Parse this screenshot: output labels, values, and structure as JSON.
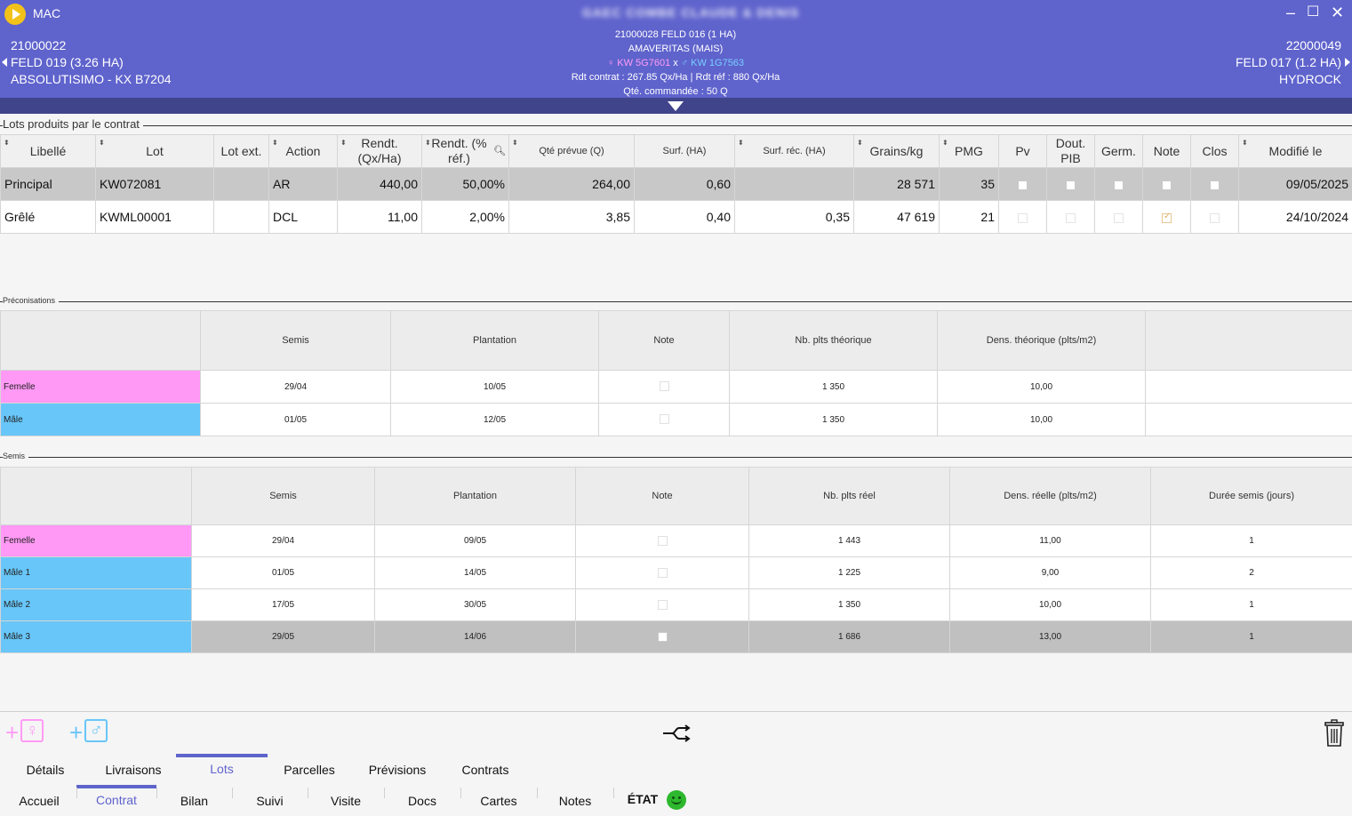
{
  "header": {
    "app_title": "MAC",
    "blurred_title": "GAEC COMBE CLAUDE & DENIS",
    "prev": {
      "line1": "21000022",
      "line2": "FELD 019 (3.26 HA)",
      "line3": "ABSOLUTISIMO - KX B7204"
    },
    "next": {
      "line1": "22000049",
      "line2": "FELD 017 (1.2 HA)",
      "line3": "HYDROCK"
    },
    "center": {
      "line1": "21000028 FELD 016 (1 HA)",
      "line2": "AMAVERITAS (MAIS)",
      "female": "KW 5G7601",
      "x": "x",
      "male": "KW 1G7563",
      "line4": "Rdt contrat : 267.85 Qx/Ha | Rdt réf : 880 Qx/Ha",
      "line5": "Qté. commandée : 50 Q"
    }
  },
  "lots": {
    "title": "Lots produits par le contrat",
    "headers": [
      "Libellé",
      "Lot",
      "Lot ext.",
      "Action",
      "Rendt. (Qx/Ha)",
      "Rendt. (% réf.)",
      "Qté prévue (Q)",
      "Surf. (HA)",
      "Surf. réc. (HA)",
      "Grains/kg",
      "PMG",
      "Pv",
      "Dout. PIB",
      "Germ.",
      "Note",
      "Clos",
      "Modifié le"
    ],
    "rows": [
      {
        "libelle": "Principal",
        "lot": "KW072081",
        "lot_ext": "",
        "action": "AR",
        "rendt": "440,00",
        "rendt_pct": "50,00%",
        "qte": "264,00",
        "surf": "0,60",
        "surf_rec": "",
        "grains": "28 571",
        "pmg": "35",
        "modifie": "09/05/2025"
      },
      {
        "libelle": "Grêlé",
        "lot": "KWML00001",
        "lot_ext": "",
        "action": "DCL",
        "rendt": "11,00",
        "rendt_pct": "2,00%",
        "qte": "3,85",
        "surf": "0,40",
        "surf_rec": "0,35",
        "grains": "47 619",
        "pmg": "21",
        "modifie": "24/10/2024"
      }
    ]
  },
  "precon": {
    "title": "Préconisations",
    "headers": [
      "Semis",
      "Plantation",
      "Note",
      "Nb. plts théorique",
      "Dens. théorique (plts/m2)"
    ],
    "rows": [
      {
        "label": "Femelle",
        "semis": "29/04",
        "plantation": "10/05",
        "nb": "1 350",
        "dens": "10,00"
      },
      {
        "label": "Mâle",
        "semis": "01/05",
        "plantation": "12/05",
        "nb": "1 350",
        "dens": "10,00"
      }
    ]
  },
  "semis": {
    "title": "Semis",
    "headers": [
      "Semis",
      "Plantation",
      "Note",
      "Nb. plts réel",
      "Dens. réelle (plts/m2)",
      "Durée semis (jours)"
    ],
    "rows": [
      {
        "label": "Femelle",
        "semis": "29/04",
        "plantation": "09/05",
        "nb": "1 443",
        "dens": "11,00",
        "duree": "1"
      },
      {
        "label": "Mâle 1",
        "semis": "01/05",
        "plantation": "14/05",
        "nb": "1 225",
        "dens": "9,00",
        "duree": "2"
      },
      {
        "label": "Mâle 2",
        "semis": "17/05",
        "plantation": "30/05",
        "nb": "1 350",
        "dens": "10,00",
        "duree": "1"
      },
      {
        "label": "Mâle 3",
        "semis": "29/05",
        "plantation": "14/06",
        "nb": "1 686",
        "dens": "13,00",
        "duree": "1"
      }
    ]
  },
  "toolbar": {
    "plus": "+",
    "female_symbol": "♀",
    "male_symbol": "♂"
  },
  "tabs_top": [
    "Détails",
    "Livraisons",
    "Lots",
    "Parcelles",
    "Prévisions",
    "Contrats"
  ],
  "tabs_bottom": [
    "Accueil",
    "Contrat",
    "Bilan",
    "Suivi",
    "Visite",
    "Docs",
    "Cartes",
    "Notes",
    "ÉTAT"
  ],
  "colors": {
    "accent": "#5f63cc",
    "female": "#ff99f5",
    "male": "#68c6f9",
    "status_ok": "#2eb82e"
  }
}
